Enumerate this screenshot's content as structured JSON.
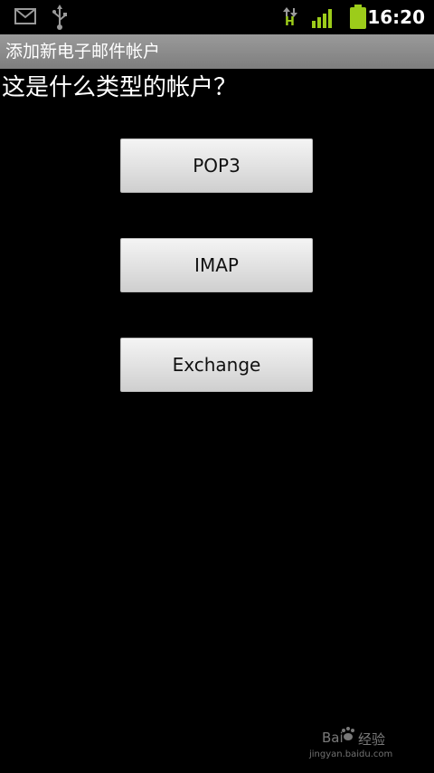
{
  "status_bar": {
    "time": "16:20",
    "data_type": "H",
    "icons": [
      "gmail-icon",
      "usb-icon",
      "data-activity-icon",
      "signal-icon",
      "battery-icon"
    ],
    "accent_color": "#9ccc1a"
  },
  "title_bar": {
    "title": "添加新电子邮件帐户"
  },
  "main": {
    "question": "这是什么类型的帐户？",
    "buttons": [
      {
        "label": "POP3"
      },
      {
        "label": "IMAP"
      },
      {
        "label": "Exchange"
      }
    ]
  },
  "watermark": {
    "brand_prefix": "Bai",
    "brand_suffix": "经验",
    "url": "jingyan.baidu.com"
  }
}
